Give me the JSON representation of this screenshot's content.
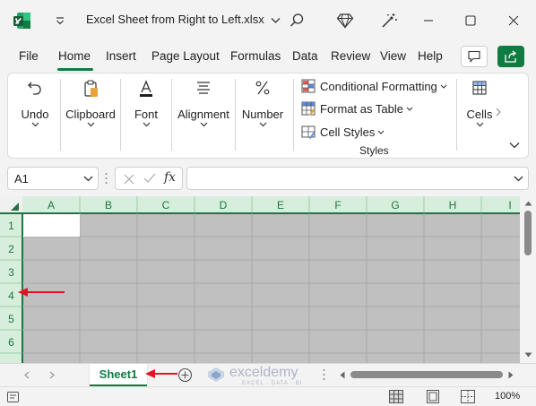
{
  "window": {
    "title": "Excel Sheet from Right to Left.xlsx",
    "title_chevron": "⌄"
  },
  "tabs": [
    {
      "label": "File"
    },
    {
      "label": "Home",
      "active": true
    },
    {
      "label": "Insert"
    },
    {
      "label": "Page Layout"
    },
    {
      "label": "Formulas"
    },
    {
      "label": "Data"
    },
    {
      "label": "Review"
    },
    {
      "label": "View"
    },
    {
      "label": "Help"
    }
  ],
  "ribbon": {
    "undo": "Undo",
    "clipboard": "Clipboard",
    "font": "Font",
    "alignment": "Alignment",
    "number": "Number",
    "styles": {
      "conditional_formatting": "Conditional Formatting",
      "format_as_table": "Format as Table",
      "cell_styles": "Cell Styles",
      "group_label": "Styles"
    },
    "cells": "Cells"
  },
  "formula_bar": {
    "name_box": "A1",
    "fx": "fx",
    "formula": ""
  },
  "grid": {
    "columns": [
      "A",
      "B",
      "C",
      "D",
      "E",
      "F",
      "G",
      "H",
      "I"
    ],
    "rows": [
      "1",
      "2",
      "3",
      "4",
      "5",
      "6"
    ],
    "selected_cell": "A1"
  },
  "sheets": [
    {
      "name": "Sheet1",
      "active": true
    }
  ],
  "watermark": {
    "brand": "exceldemy",
    "tagline": "EXCEL · DATA · BI"
  },
  "status": {
    "zoom": "100%"
  },
  "colors": {
    "accent": "#107c41",
    "grid_gray": "#c0c0c0",
    "header_green": "#d6eedb",
    "arrow_red": "#e81123"
  }
}
